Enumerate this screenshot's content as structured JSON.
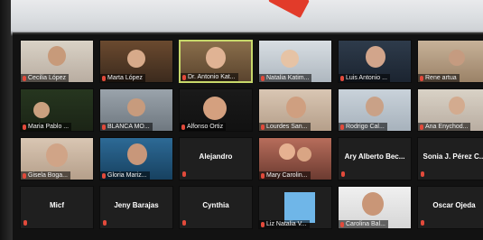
{
  "colors": {
    "accent_red": "#e24a3b",
    "active_speaker": "#c7d86a",
    "avatar_blue": "#6fb6e8"
  },
  "tiles": [
    {
      "name": "Cecilia López",
      "kind": "video"
    },
    {
      "name": "Marta López",
      "kind": "video"
    },
    {
      "name": "Dr. Antonio Kat...",
      "kind": "video",
      "active": true
    },
    {
      "name": "Natalia Katim...",
      "kind": "video"
    },
    {
      "name": "Luis Antonio ...",
      "kind": "video"
    },
    {
      "name": "Rene artua",
      "kind": "video"
    },
    {
      "name": "Maria Pablo ...",
      "kind": "video"
    },
    {
      "name": "BLANCA MO...",
      "kind": "video"
    },
    {
      "name": "Alfonso Ortiz",
      "kind": "video"
    },
    {
      "name": "Lourdes San...",
      "kind": "video"
    },
    {
      "name": "Rodrigo Cal...",
      "kind": "video"
    },
    {
      "name": "Ana Enychod...",
      "kind": "video"
    },
    {
      "name": "Gisela Boga...",
      "kind": "video"
    },
    {
      "name": "Gloria Mariz...",
      "kind": "video"
    },
    {
      "name": "Alejandro",
      "kind": "name"
    },
    {
      "name": "Mary Carolin...",
      "kind": "video"
    },
    {
      "name": "Ary Alberto Bec...",
      "kind": "name"
    },
    {
      "name": "Sonia J. Pérez C...",
      "kind": "name"
    },
    {
      "name": "Micf",
      "kind": "name"
    },
    {
      "name": "Jeny Barajas",
      "kind": "name"
    },
    {
      "name": "Cynthia",
      "kind": "name"
    },
    {
      "name": "Liz Natalia V...",
      "kind": "avatar"
    },
    {
      "name": "Carolina Bal...",
      "kind": "video"
    },
    {
      "name": "Oscar Ojeda",
      "kind": "name"
    }
  ]
}
